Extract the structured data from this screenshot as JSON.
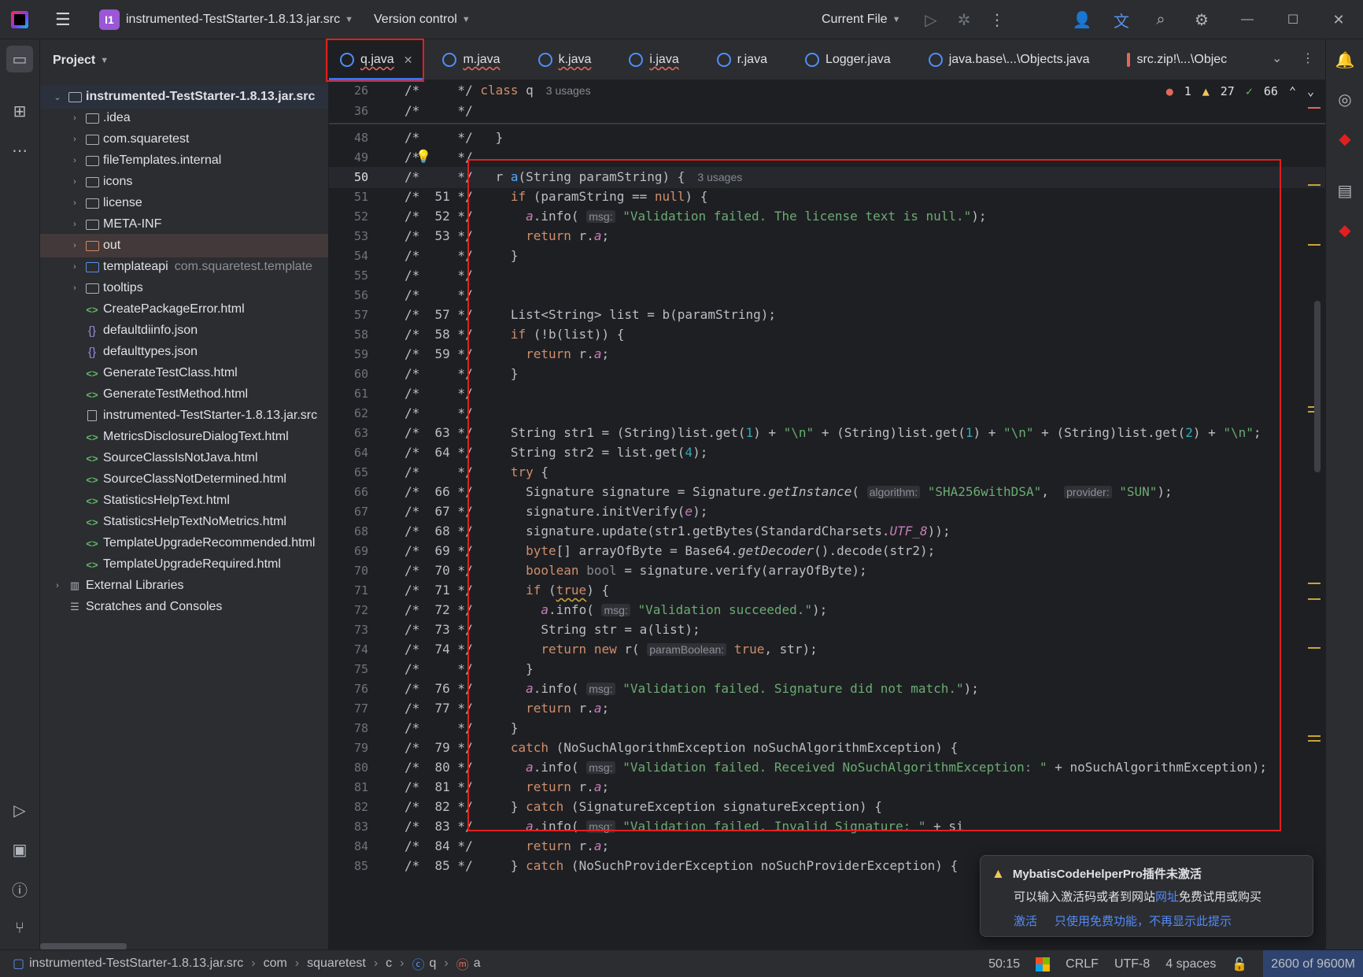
{
  "titlebar": {
    "project_badge": "I1",
    "project_name": "instrumented-TestStarter-1.8.13.jar.src",
    "version_control": "Version control",
    "run_config": "Current File"
  },
  "project_panel": {
    "title": "Project",
    "root": "instrumented-TestStarter-1.8.13.jar.src",
    "items": [
      {
        "label": "instrumented-TestStarter-1.8.13.jar.src",
        "type": "root"
      },
      {
        "label": ".idea",
        "type": "folder"
      },
      {
        "label": "com.squaretest",
        "type": "folder"
      },
      {
        "label": "fileTemplates.internal",
        "type": "folder"
      },
      {
        "label": "icons",
        "type": "folder"
      },
      {
        "label": "license",
        "type": "folder"
      },
      {
        "label": "META-INF",
        "type": "folder"
      },
      {
        "label": "out",
        "type": "folder-orange"
      },
      {
        "label": "templateapi",
        "type": "folder-blue",
        "hint": "com.squaretest.template"
      },
      {
        "label": "tooltips",
        "type": "folder"
      },
      {
        "label": "CreatePackageError.html",
        "type": "html"
      },
      {
        "label": "defaultdiinfo.json",
        "type": "json"
      },
      {
        "label": "defaulttypes.json",
        "type": "json"
      },
      {
        "label": "GenerateTestClass.html",
        "type": "html"
      },
      {
        "label": "GenerateTestMethod.html",
        "type": "html"
      },
      {
        "label": "instrumented-TestStarter-1.8.13.jar.src",
        "type": "file"
      },
      {
        "label": "MetricsDisclosureDialogText.html",
        "type": "html"
      },
      {
        "label": "SourceClassIsNotJava.html",
        "type": "html"
      },
      {
        "label": "SourceClassNotDetermined.html",
        "type": "html"
      },
      {
        "label": "StatisticsHelpText.html",
        "type": "html"
      },
      {
        "label": "StatisticsHelpTextNoMetrics.html",
        "type": "html"
      },
      {
        "label": "TemplateUpgradeRecommended.html",
        "type": "html"
      },
      {
        "label": "TemplateUpgradeRequired.html",
        "type": "html"
      },
      {
        "label": "External Libraries",
        "type": "lib"
      },
      {
        "label": "Scratches and Consoles",
        "type": "scratch"
      }
    ]
  },
  "tabs": [
    {
      "label": "q.java",
      "active": true
    },
    {
      "label": "m.java"
    },
    {
      "label": "k.java"
    },
    {
      "label": "i.java"
    },
    {
      "label": "r.java"
    },
    {
      "label": "Logger.java"
    },
    {
      "label": "java.base\\...\\Objects.java"
    },
    {
      "label": "src.zip!\\...\\Objec"
    }
  ],
  "editor": {
    "inspections": {
      "errors": "1",
      "warnings": "27",
      "ok": "66"
    },
    "usages": "3 usages",
    "lines": [
      {
        "n": "26",
        "orig": "",
        "code": "*/ class q"
      },
      {
        "n": "36",
        "orig": "",
        "code": "*/"
      },
      {
        "n": "48",
        "orig": "",
        "code": "*/   }"
      },
      {
        "n": "49",
        "orig": "",
        "code": "*/"
      },
      {
        "n": "50",
        "orig": "",
        "code": "*/   r a(String paramString) {"
      },
      {
        "n": "51",
        "orig": "51",
        "code": "*/     if (paramString == null) {"
      },
      {
        "n": "52",
        "orig": "52",
        "code": "*/       a.info( msg: \"Validation failed. The license text is null.\");"
      },
      {
        "n": "53",
        "orig": "53",
        "code": "*/       return r.a;"
      },
      {
        "n": "54",
        "orig": "",
        "code": "*/     }"
      },
      {
        "n": "55",
        "orig": "",
        "code": "*/"
      },
      {
        "n": "56",
        "orig": "",
        "code": "*/"
      },
      {
        "n": "57",
        "orig": "57",
        "code": "*/     List<String> list = b(paramString);"
      },
      {
        "n": "58",
        "orig": "58",
        "code": "*/     if (!b(list)) {"
      },
      {
        "n": "59",
        "orig": "59",
        "code": "*/       return r.a;"
      },
      {
        "n": "60",
        "orig": "",
        "code": "*/     }"
      },
      {
        "n": "61",
        "orig": "",
        "code": "*/"
      },
      {
        "n": "62",
        "orig": "",
        "code": "*/"
      },
      {
        "n": "63",
        "orig": "63",
        "code": "*/     String str1 = (String)list.get(1) + \"\\n\" + (String)list.get(1) + \"\\n\" + (String)list.get(2) + \"\\n\";"
      },
      {
        "n": "64",
        "orig": "64",
        "code": "*/     String str2 = list.get(4);"
      },
      {
        "n": "65",
        "orig": "",
        "code": "*/     try {"
      },
      {
        "n": "66",
        "orig": "66",
        "code": "*/       Signature signature = Signature.getInstance( algorithm: \"SHA256withDSA\",  provider: \"SUN\");"
      },
      {
        "n": "67",
        "orig": "67",
        "code": "*/       signature.initVerify(e);"
      },
      {
        "n": "68",
        "orig": "68",
        "code": "*/       signature.update(str1.getBytes(StandardCharsets.UTF_8));"
      },
      {
        "n": "69",
        "orig": "69",
        "code": "*/       byte[] arrayOfByte = Base64.getDecoder().decode(str2);"
      },
      {
        "n": "70",
        "orig": "70",
        "code": "*/       boolean bool = signature.verify(arrayOfByte);"
      },
      {
        "n": "71",
        "orig": "71",
        "code": "*/       if (true) {"
      },
      {
        "n": "72",
        "orig": "72",
        "code": "*/         a.info( msg: \"Validation succeeded.\");"
      },
      {
        "n": "73",
        "orig": "73",
        "code": "*/         String str = a(list);"
      },
      {
        "n": "74",
        "orig": "74",
        "code": "*/         return new r( paramBoolean: true, str);"
      },
      {
        "n": "75",
        "orig": "",
        "code": "*/       }"
      },
      {
        "n": "76",
        "orig": "76",
        "code": "*/       a.info( msg: \"Validation failed. Signature did not match.\");"
      },
      {
        "n": "77",
        "orig": "77",
        "code": "*/       return r.a;"
      },
      {
        "n": "78",
        "orig": "",
        "code": "*/     }"
      },
      {
        "n": "79",
        "orig": "79",
        "code": "*/     catch (NoSuchAlgorithmException noSuchAlgorithmException) {"
      },
      {
        "n": "80",
        "orig": "80",
        "code": "*/       a.info( msg: \"Validation failed. Received NoSuchAlgorithmException: \" + noSuchAlgorithmException);"
      },
      {
        "n": "81",
        "orig": "81",
        "code": "*/       return r.a;"
      },
      {
        "n": "82",
        "orig": "82",
        "code": "*/     } catch (SignatureException signatureException) {"
      },
      {
        "n": "83",
        "orig": "83",
        "code": "*/       a.info( msg: \"Validation failed. Invalid Signature: \" + si"
      },
      {
        "n": "84",
        "orig": "84",
        "code": "*/       return r.a;"
      },
      {
        "n": "85",
        "orig": "85",
        "code": "*/     } catch (NoSuchProviderException noSuchProviderException) {"
      }
    ]
  },
  "notification": {
    "title": "MybatisCodeHelperPro插件未激活",
    "body_prefix": "可以输入激活码或者到网站",
    "body_link": "网址",
    "body_suffix": "免费试用或购买",
    "action_activate": "激活",
    "action_free": "只使用免费功能，不再显示此提示"
  },
  "statusbar": {
    "crumbs": [
      "instrumented-TestStarter-1.8.13.jar.src",
      "com",
      "squaretest",
      "c",
      "q",
      "a"
    ],
    "position": "50:15",
    "line_sep": "CRLF",
    "encoding": "UTF-8",
    "indent": "4 spaces",
    "memory": "2600 of 9600M"
  },
  "colors": {
    "accent": "#3574f0",
    "annotation_red": "#e02020"
  }
}
